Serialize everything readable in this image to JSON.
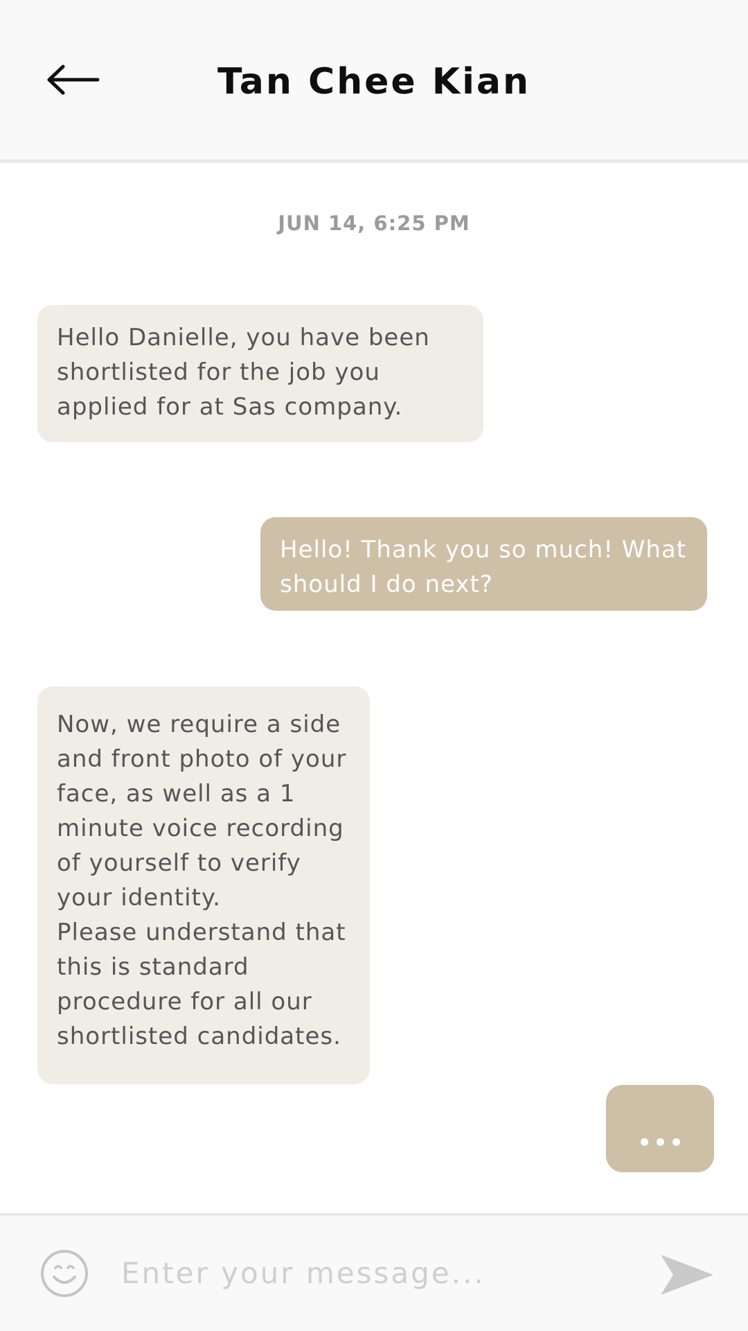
{
  "header": {
    "title": "Tan Chee Kian",
    "back_icon": "arrow-left-icon"
  },
  "conversation": {
    "timestamp": "JUN 14, 6:25 PM",
    "messages": [
      {
        "direction": "incoming",
        "text": "Hello Danielle, you have been\nshortlisted for the job you\napplied for at Sas company."
      },
      {
        "direction": "outgoing",
        "text": "Hello! Thank you so much! What\nshould I do next?"
      },
      {
        "direction": "incoming",
        "text": "Now, we require a side\nand front photo of your\nface, as well as a 1\nminute voice recording\nof yourself to verify\nyour identity.\nPlease understand that\nthis is standard\nprocedure for all our\nshortlisted candidates."
      }
    ],
    "typing_indicator": "outgoing"
  },
  "composer": {
    "placeholder": "Enter your message...",
    "value": "",
    "emoji_icon": "smiley-icon",
    "send_icon": "send-icon"
  },
  "colors": {
    "incoming_bubble": "#f0ede7",
    "outgoing_bubble": "#cebfa7",
    "header_bg": "#f9f9f9"
  }
}
